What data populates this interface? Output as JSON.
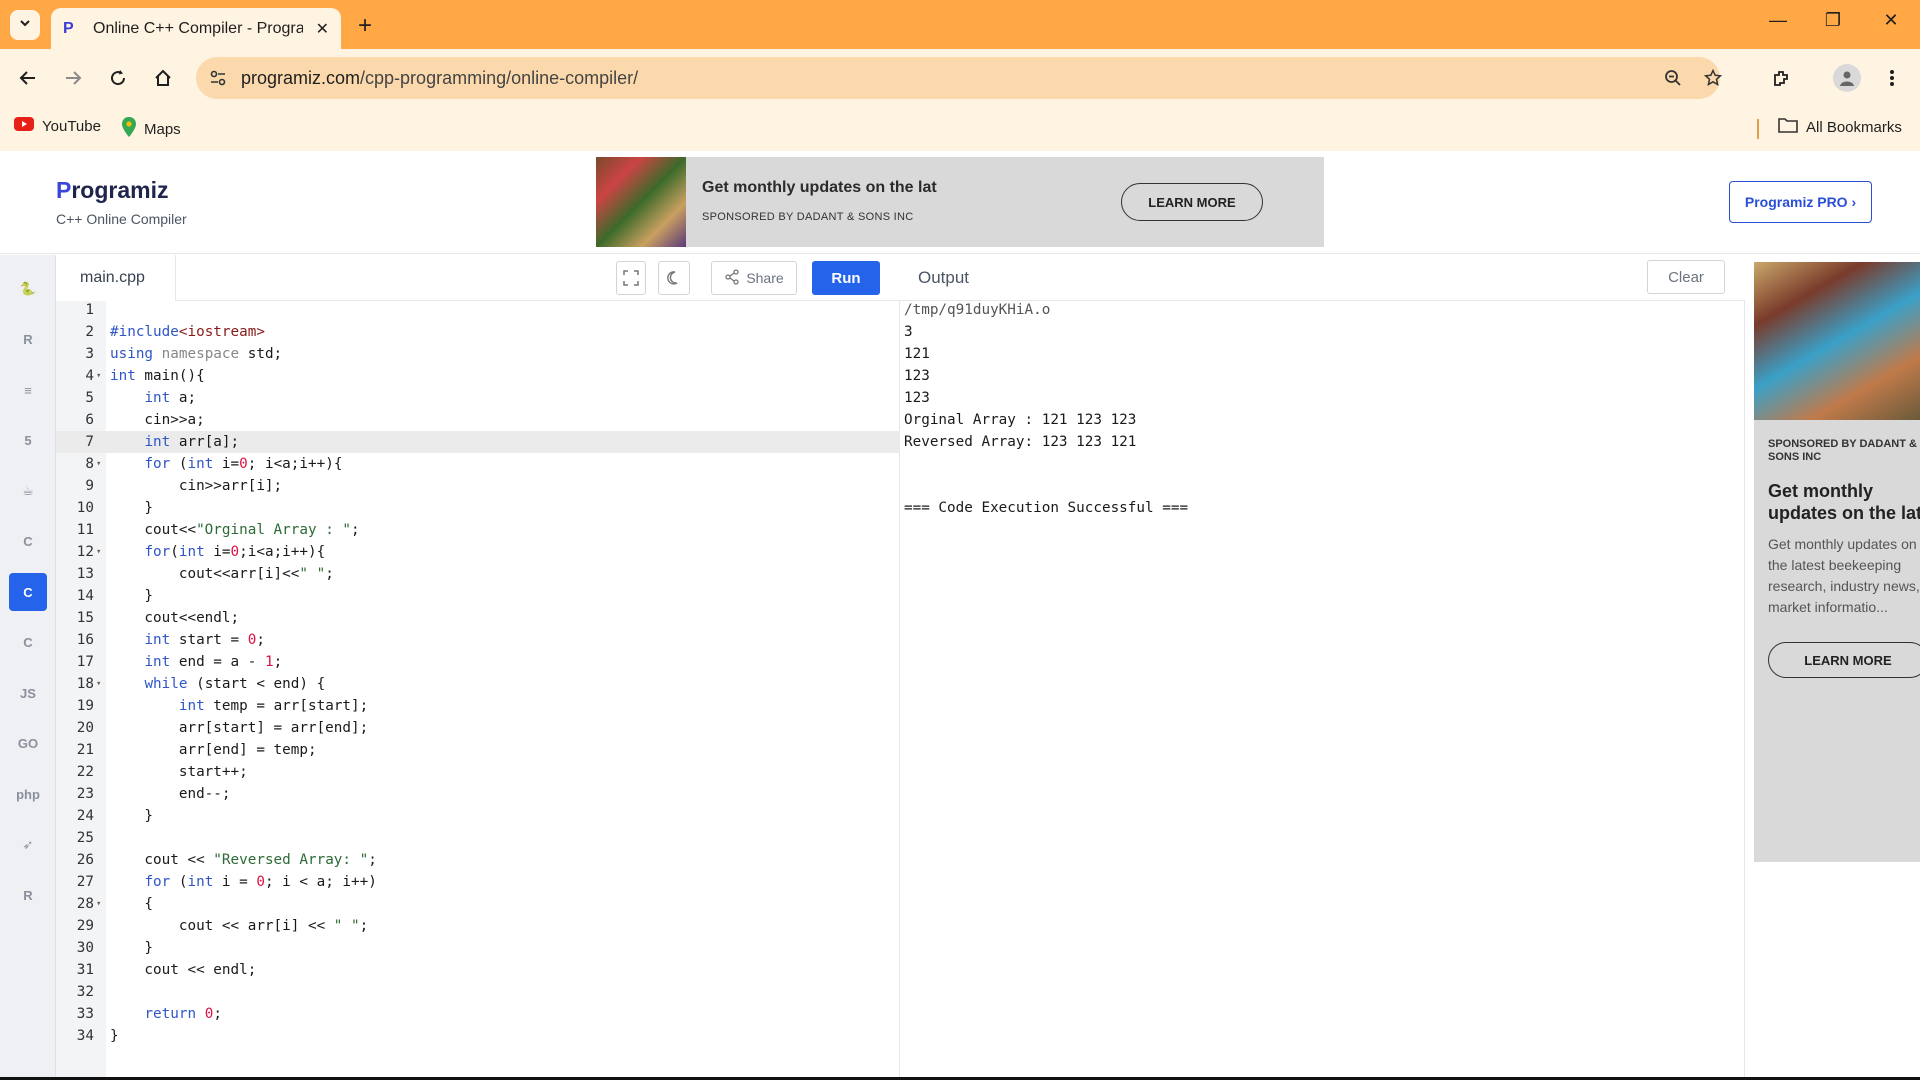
{
  "browser": {
    "tab_title": "Online C++ Compiler - Programiz",
    "url_host": "programiz.com",
    "url_path": "/cpp-programming/online-compiler/",
    "bookmarks": [
      {
        "label": "YouTube",
        "icon": "youtube-icon"
      },
      {
        "label": "Maps",
        "icon": "maps-icon"
      }
    ],
    "all_bookmarks": "All Bookmarks",
    "accent": "#ffa845",
    "chrome_bg": "#fff3e2"
  },
  "site": {
    "logo_text": "rogramiz",
    "logo_initial": "P",
    "subtitle": "C++ Online Compiler",
    "pro_button": "Programiz PRO ›"
  },
  "banner_ad": {
    "headline": "Get monthly updates on the lat",
    "sponsor": "SPONSORED BY DADANT & SONS INC",
    "cta": "LEARN MORE"
  },
  "languages": [
    {
      "name": "python-icon",
      "glyph": "🐍"
    },
    {
      "name": "r-icon",
      "glyph": "R"
    },
    {
      "name": "sql-icon",
      "glyph": "≡"
    },
    {
      "name": "html-icon",
      "glyph": "5"
    },
    {
      "name": "java-icon",
      "glyph": "☕"
    },
    {
      "name": "c-icon",
      "glyph": "C"
    },
    {
      "name": "cpp-icon",
      "glyph": "C",
      "active": true
    },
    {
      "name": "csharp-icon",
      "glyph": "C"
    },
    {
      "name": "js-icon",
      "glyph": "JS"
    },
    {
      "name": "go-icon",
      "glyph": "GO"
    },
    {
      "name": "php-icon",
      "glyph": "php"
    },
    {
      "name": "swift-icon",
      "glyph": "➶"
    },
    {
      "name": "rust-icon",
      "glyph": "R"
    }
  ],
  "editor": {
    "file_name": "main.cpp",
    "share_label": "Share",
    "run_label": "Run",
    "active_line": 7,
    "lines": [
      "",
      "#include<iostream>",
      "using namespace std;",
      "int main(){",
      "    int a;",
      "    cin>>a;",
      "    int arr[a];",
      "    for (int i=0; i<a;i++){",
      "        cin>>arr[i];",
      "    }",
      "    cout<<\"Orginal Array : \";",
      "    for(int i=0;i<a;i++){",
      "        cout<<arr[i]<<\" \";",
      "    }",
      "    cout<<endl;",
      "    int start = 0;",
      "    int end = a - 1;",
      "    while (start < end) {",
      "        int temp = arr[start];",
      "        arr[start] = arr[end];",
      "        arr[end] = temp;",
      "        start++;",
      "        end--;",
      "    }",
      "",
      "    cout << \"Reversed Array: \";",
      "    for (int i = 0; i < a; i++)",
      "    {",
      "        cout << arr[i] << \" \";",
      "    }",
      "    cout << endl;",
      "",
      "    return 0;",
      "}"
    ],
    "fold_lines": [
      4,
      8,
      12,
      18,
      28
    ]
  },
  "output": {
    "title": "Output",
    "clear_label": "Clear",
    "lines": [
      "/tmp/q91duyKHiA.o",
      "3",
      "121",
      "123",
      "123",
      "Orginal Array : 121 123 123",
      "Reversed Array: 123 123 121",
      "",
      "",
      "=== Code Execution Successful ==="
    ]
  },
  "side_ad": {
    "sponsor": "SPONSORED BY DADANT & SONS INC",
    "headline": "Get monthly updates on the lat",
    "body": "Get monthly updates on the latest beekeeping research, industry news, market informatio...",
    "cta": "LEARN MORE"
  }
}
